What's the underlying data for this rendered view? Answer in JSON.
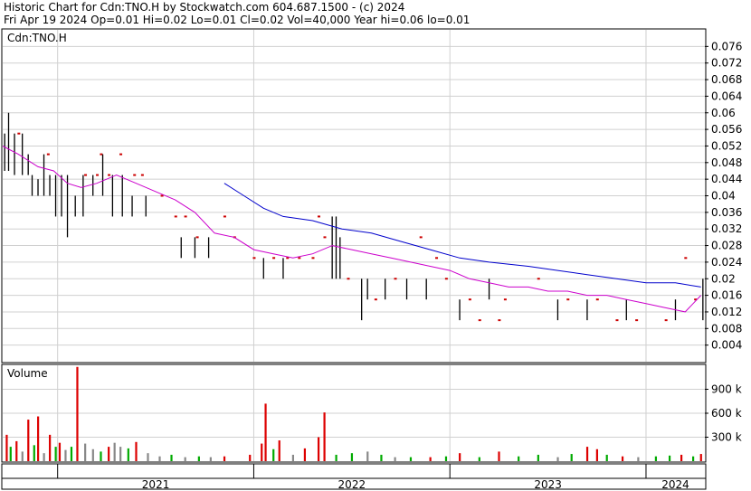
{
  "header": {
    "line1": "Historic Chart for Cdn:TNO.H by Stockwatch.com 604.687.1500 - (c) 2024",
    "line2": "Fri Apr 19 2024   Op=0.01  Hi=0.02  Lo=0.01  Cl=0.02  Vol=40,000  Year hi=0.06  lo=0.01"
  },
  "chart_data": [
    {
      "type": "ohlc",
      "title": "Cdn:TNO.H",
      "ylim": [
        0,
        0.08
      ],
      "y_ticks": [
        "0.076",
        "0.072",
        "0.068",
        "0.064",
        "0.06",
        "0.056",
        "0.052",
        "0.048",
        "0.044",
        "0.04",
        "0.036",
        "0.032",
        "0.028",
        "0.024",
        "0.02",
        "0.016",
        "0.012",
        "0.008",
        "0.004"
      ],
      "x_range": [
        2020.72,
        2024.3
      ],
      "x_labels": [
        {
          "label": "2021",
          "x": 2021.0
        },
        {
          "label": "2022",
          "x": 2022.0
        },
        {
          "label": "2023",
          "x": 2023.0
        },
        {
          "label": "2024",
          "x": 2024.0
        }
      ],
      "colors": {
        "bars": "#000000",
        "flat_days": "#cc0000",
        "ma_long": "#0000cc",
        "ma_short": "#cc00cc"
      },
      "bars": [
        [
          2020.73,
          0.055,
          0.046
        ],
        [
          2020.75,
          0.06,
          0.046
        ],
        [
          2020.78,
          0.055,
          0.045
        ],
        [
          2020.82,
          0.055,
          0.045
        ],
        [
          2020.85,
          0.05,
          0.045
        ],
        [
          2020.87,
          0.045,
          0.04
        ],
        [
          2020.9,
          0.044,
          0.04
        ],
        [
          2020.93,
          0.05,
          0.04
        ],
        [
          2020.96,
          0.045,
          0.04
        ],
        [
          2020.99,
          0.045,
          0.035
        ],
        [
          2021.02,
          0.045,
          0.035
        ],
        [
          2021.05,
          0.045,
          0.03
        ],
        [
          2021.09,
          0.04,
          0.035
        ],
        [
          2021.13,
          0.045,
          0.035
        ],
        [
          2021.18,
          0.045,
          0.04
        ],
        [
          2021.23,
          0.05,
          0.04
        ],
        [
          2021.28,
          0.045,
          0.035
        ],
        [
          2021.33,
          0.045,
          0.035
        ],
        [
          2021.38,
          0.04,
          0.035
        ],
        [
          2021.45,
          0.04,
          0.035
        ],
        [
          2021.56,
          0.03,
          0.03
        ],
        [
          2021.63,
          0.03,
          0.025
        ],
        [
          2021.7,
          0.03,
          0.025
        ],
        [
          2021.77,
          0.03,
          0.025
        ],
        [
          2021.82,
          0.025,
          0.025
        ],
        [
          2021.92,
          0.025,
          0.025
        ],
        [
          2022.05,
          0.025,
          0.02
        ],
        [
          2022.15,
          0.025,
          0.02
        ],
        [
          2022.27,
          0.025,
          0.025
        ],
        [
          2022.4,
          0.035,
          0.02
        ],
        [
          2022.42,
          0.035,
          0.02
        ],
        [
          2022.44,
          0.03,
          0.02
        ],
        [
          2022.55,
          0.02,
          0.01
        ],
        [
          2022.58,
          0.02,
          0.015
        ],
        [
          2022.67,
          0.02,
          0.015
        ],
        [
          2022.78,
          0.02,
          0.015
        ],
        [
          2022.88,
          0.02,
          0.015
        ],
        [
          2023.05,
          0.015,
          0.01
        ],
        [
          2023.2,
          0.02,
          0.015
        ],
        [
          2023.35,
          0.015,
          0.015
        ],
        [
          2023.55,
          0.015,
          0.01
        ],
        [
          2023.7,
          0.015,
          0.01
        ],
        [
          2023.9,
          0.015,
          0.01
        ],
        [
          2024.15,
          0.015,
          0.01
        ],
        [
          2024.29,
          0.02,
          0.01
        ]
      ],
      "flat_days": [
        [
          2020.8,
          0.055
        ],
        [
          2020.95,
          0.05
        ],
        [
          2021.14,
          0.045
        ],
        [
          2021.2,
          0.045
        ],
        [
          2021.22,
          0.05
        ],
        [
          2021.26,
          0.045
        ],
        [
          2021.32,
          0.05
        ],
        [
          2021.39,
          0.045
        ],
        [
          2021.43,
          0.045
        ],
        [
          2021.53,
          0.04
        ],
        [
          2021.6,
          0.035
        ],
        [
          2021.65,
          0.035
        ],
        [
          2021.71,
          0.03
        ],
        [
          2021.85,
          0.035
        ],
        [
          2021.9,
          0.03
        ],
        [
          2022.0,
          0.025
        ],
        [
          2022.1,
          0.025
        ],
        [
          2022.17,
          0.025
        ],
        [
          2022.23,
          0.025
        ],
        [
          2022.3,
          0.025
        ],
        [
          2022.33,
          0.035
        ],
        [
          2022.36,
          0.03
        ],
        [
          2022.48,
          0.02
        ],
        [
          2022.62,
          0.015
        ],
        [
          2022.72,
          0.02
        ],
        [
          2022.85,
          0.03
        ],
        [
          2022.93,
          0.025
        ],
        [
          2022.98,
          0.02
        ],
        [
          2023.1,
          0.015
        ],
        [
          2023.15,
          0.01
        ],
        [
          2023.25,
          0.01
        ],
        [
          2023.28,
          0.015
        ],
        [
          2023.45,
          0.02
        ],
        [
          2023.6,
          0.015
        ],
        [
          2023.75,
          0.015
        ],
        [
          2023.85,
          0.01
        ],
        [
          2023.95,
          0.01
        ],
        [
          2024.1,
          0.01
        ],
        [
          2024.2,
          0.025
        ],
        [
          2024.25,
          0.015
        ]
      ],
      "ma_long": [
        [
          2021.85,
          0.043
        ],
        [
          2021.95,
          0.04
        ],
        [
          2022.05,
          0.037
        ],
        [
          2022.15,
          0.035
        ],
        [
          2022.3,
          0.034
        ],
        [
          2022.45,
          0.032
        ],
        [
          2022.6,
          0.031
        ],
        [
          2022.75,
          0.029
        ],
        [
          2022.9,
          0.027
        ],
        [
          2023.05,
          0.025
        ],
        [
          2023.2,
          0.024
        ],
        [
          2023.4,
          0.023
        ],
        [
          2023.55,
          0.022
        ],
        [
          2023.7,
          0.021
        ],
        [
          2023.85,
          0.02
        ],
        [
          2024.0,
          0.019
        ],
        [
          2024.15,
          0.019
        ],
        [
          2024.28,
          0.018
        ]
      ],
      "ma_short": [
        [
          2020.72,
          0.052
        ],
        [
          2020.8,
          0.05
        ],
        [
          2020.9,
          0.047
        ],
        [
          2020.98,
          0.046
        ],
        [
          2021.05,
          0.043
        ],
        [
          2021.12,
          0.042
        ],
        [
          2021.2,
          0.043
        ],
        [
          2021.3,
          0.045
        ],
        [
          2021.4,
          0.043
        ],
        [
          2021.5,
          0.041
        ],
        [
          2021.6,
          0.039
        ],
        [
          2021.7,
          0.036
        ],
        [
          2021.8,
          0.031
        ],
        [
          2021.9,
          0.03
        ],
        [
          2022.0,
          0.027
        ],
        [
          2022.1,
          0.026
        ],
        [
          2022.2,
          0.025
        ],
        [
          2022.3,
          0.026
        ],
        [
          2022.4,
          0.028
        ],
        [
          2022.5,
          0.027
        ],
        [
          2022.6,
          0.026
        ],
        [
          2022.7,
          0.025
        ],
        [
          2022.8,
          0.024
        ],
        [
          2022.9,
          0.023
        ],
        [
          2023.0,
          0.022
        ],
        [
          2023.1,
          0.02
        ],
        [
          2023.2,
          0.019
        ],
        [
          2023.3,
          0.018
        ],
        [
          2023.4,
          0.018
        ],
        [
          2023.5,
          0.017
        ],
        [
          2023.6,
          0.017
        ],
        [
          2023.7,
          0.016
        ],
        [
          2023.8,
          0.016
        ],
        [
          2023.9,
          0.015
        ],
        [
          2024.0,
          0.014
        ],
        [
          2024.1,
          0.013
        ],
        [
          2024.2,
          0.012
        ],
        [
          2024.28,
          0.016
        ]
      ]
    },
    {
      "type": "bar",
      "title": "Volume",
      "ylim": [
        0,
        1200000
      ],
      "y_ticks": [
        "900 k",
        "600 k",
        "300 k"
      ],
      "colors": {
        "up": "#00aa00",
        "down": "#dd0000",
        "flat": "#888888"
      },
      "volumes": [
        [
          2020.74,
          330000,
          "down"
        ],
        [
          2020.76,
          180000,
          "up"
        ],
        [
          2020.79,
          250000,
          "down"
        ],
        [
          2020.82,
          120000,
          "flat"
        ],
        [
          2020.85,
          520000,
          "down"
        ],
        [
          2020.88,
          200000,
          "up"
        ],
        [
          2020.9,
          560000,
          "down"
        ],
        [
          2020.93,
          100000,
          "flat"
        ],
        [
          2020.96,
          330000,
          "down"
        ],
        [
          2020.99,
          180000,
          "up"
        ],
        [
          2021.01,
          230000,
          "down"
        ],
        [
          2021.04,
          140000,
          "flat"
        ],
        [
          2021.07,
          180000,
          "up"
        ],
        [
          2021.1,
          1180000,
          "down"
        ],
        [
          2021.14,
          220000,
          "flat"
        ],
        [
          2021.18,
          150000,
          "flat"
        ],
        [
          2021.22,
          120000,
          "up"
        ],
        [
          2021.26,
          180000,
          "down"
        ],
        [
          2021.29,
          230000,
          "flat"
        ],
        [
          2021.32,
          180000,
          "flat"
        ],
        [
          2021.36,
          160000,
          "up"
        ],
        [
          2021.4,
          240000,
          "down"
        ],
        [
          2021.46,
          100000,
          "flat"
        ],
        [
          2021.52,
          60000,
          "flat"
        ],
        [
          2021.58,
          80000,
          "up"
        ],
        [
          2021.65,
          50000,
          "flat"
        ],
        [
          2021.72,
          60000,
          "up"
        ],
        [
          2021.78,
          50000,
          "flat"
        ],
        [
          2021.85,
          60000,
          "down"
        ],
        [
          2021.98,
          80000,
          "down"
        ],
        [
          2022.04,
          220000,
          "down"
        ],
        [
          2022.06,
          720000,
          "down"
        ],
        [
          2022.1,
          150000,
          "up"
        ],
        [
          2022.13,
          260000,
          "down"
        ],
        [
          2022.2,
          80000,
          "flat"
        ],
        [
          2022.26,
          160000,
          "down"
        ],
        [
          2022.33,
          300000,
          "down"
        ],
        [
          2022.36,
          610000,
          "down"
        ],
        [
          2022.42,
          80000,
          "up"
        ],
        [
          2022.5,
          100000,
          "up"
        ],
        [
          2022.58,
          120000,
          "flat"
        ],
        [
          2022.65,
          80000,
          "up"
        ],
        [
          2022.72,
          50000,
          "flat"
        ],
        [
          2022.8,
          50000,
          "up"
        ],
        [
          2022.9,
          50000,
          "down"
        ],
        [
          2022.98,
          60000,
          "up"
        ],
        [
          2023.05,
          100000,
          "down"
        ],
        [
          2023.15,
          50000,
          "up"
        ],
        [
          2023.25,
          120000,
          "down"
        ],
        [
          2023.35,
          60000,
          "up"
        ],
        [
          2023.45,
          80000,
          "up"
        ],
        [
          2023.55,
          50000,
          "flat"
        ],
        [
          2023.62,
          90000,
          "up"
        ],
        [
          2023.7,
          180000,
          "down"
        ],
        [
          2023.75,
          150000,
          "down"
        ],
        [
          2023.8,
          80000,
          "up"
        ],
        [
          2023.88,
          60000,
          "down"
        ],
        [
          2023.96,
          50000,
          "flat"
        ],
        [
          2024.05,
          60000,
          "up"
        ],
        [
          2024.12,
          70000,
          "up"
        ],
        [
          2024.18,
          80000,
          "down"
        ],
        [
          2024.24,
          60000,
          "up"
        ],
        [
          2024.28,
          90000,
          "down"
        ]
      ]
    }
  ]
}
